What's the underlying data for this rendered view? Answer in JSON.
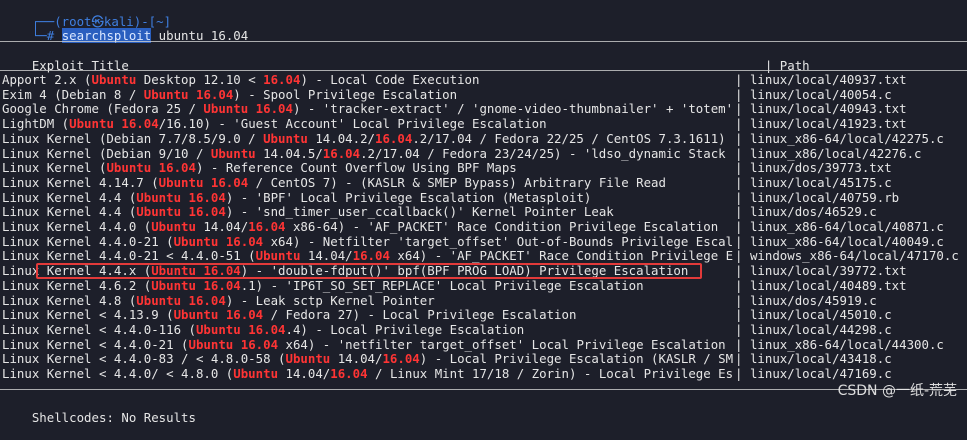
{
  "prompt": {
    "top_line": "┌──(root㉿kali)-[~]",
    "cmd_prefix": "└─# ",
    "command": "searchsploit",
    "args": " ubuntu 16.04"
  },
  "table": {
    "header_title": "Exploit Title",
    "header_pipe": "|",
    "header_path": "Path",
    "rows": [
      {
        "segments": [
          {
            "t": "Apport 2.x (",
            "c": "white"
          },
          {
            "t": "Ubuntu",
            "c": "red"
          },
          {
            "t": " Desktop 12.10 < ",
            "c": "white"
          },
          {
            "t": "16.04",
            "c": "red"
          },
          {
            "t": ") - Local Code Execution",
            "c": "white"
          }
        ],
        "path": "linux/local/40937.txt"
      },
      {
        "segments": [
          {
            "t": "Exim 4 (Debian 8 / ",
            "c": "white"
          },
          {
            "t": "Ubuntu",
            "c": "red"
          },
          {
            "t": " ",
            "c": "white"
          },
          {
            "t": "16.04",
            "c": "red"
          },
          {
            "t": ") - Spool Privilege Escalation",
            "c": "white"
          }
        ],
        "path": "linux/local/40054.c"
      },
      {
        "segments": [
          {
            "t": "Google Chrome (Fedora 25 / ",
            "c": "white"
          },
          {
            "t": "Ubuntu",
            "c": "red"
          },
          {
            "t": " ",
            "c": "white"
          },
          {
            "t": "16.04",
            "c": "red"
          },
          {
            "t": ") - 'tracker-extract' / 'gnome-video-thumbnailer' + 'totem'",
            "c": "white"
          }
        ],
        "path": "linux/local/40943.txt"
      },
      {
        "segments": [
          {
            "t": "LightDM (",
            "c": "white"
          },
          {
            "t": "Ubuntu",
            "c": "red"
          },
          {
            "t": " ",
            "c": "white"
          },
          {
            "t": "16.04",
            "c": "red"
          },
          {
            "t": "/16.10) - 'Guest Account' Local Privilege Escalation",
            "c": "white"
          }
        ],
        "path": "linux/local/41923.txt"
      },
      {
        "segments": [
          {
            "t": "Linux Kernel (Debian 7.7/8.5/9.0 / ",
            "c": "white"
          },
          {
            "t": "Ubuntu",
            "c": "red"
          },
          {
            "t": " 14.04.2/",
            "c": "white"
          },
          {
            "t": "16.04",
            "c": "red"
          },
          {
            "t": ".2/17.04 / Fedora 22/25 / CentOS 7.3.1611)",
            "c": "white"
          }
        ],
        "path": "linux_x86-64/local/42275.c"
      },
      {
        "segments": [
          {
            "t": "Linux Kernel (Debian 9/10 / ",
            "c": "white"
          },
          {
            "t": "Ubuntu",
            "c": "red"
          },
          {
            "t": " 14.04.5/",
            "c": "white"
          },
          {
            "t": "16.04",
            "c": "red"
          },
          {
            "t": ".2/17.04 / Fedora 23/24/25) - 'ldso_dynamic Stack",
            "c": "white"
          }
        ],
        "path": "linux_x86/local/42276.c"
      },
      {
        "segments": [
          {
            "t": "Linux Kernel (",
            "c": "white"
          },
          {
            "t": "Ubuntu",
            "c": "red"
          },
          {
            "t": " ",
            "c": "white"
          },
          {
            "t": "16.04",
            "c": "red"
          },
          {
            "t": ") - Reference Count Overflow Using BPF Maps",
            "c": "white"
          }
        ],
        "path": "linux/dos/39773.txt"
      },
      {
        "segments": [
          {
            "t": "Linux Kernel 4.14.7 (",
            "c": "white"
          },
          {
            "t": "Ubuntu",
            "c": "red"
          },
          {
            "t": " ",
            "c": "white"
          },
          {
            "t": "16.04",
            "c": "red"
          },
          {
            "t": " / CentOS 7) - (KASLR & SMEP Bypass) Arbitrary File Read",
            "c": "white"
          }
        ],
        "path": "linux/local/45175.c"
      },
      {
        "segments": [
          {
            "t": "Linux Kernel 4.4 (",
            "c": "white"
          },
          {
            "t": "Ubuntu",
            "c": "red"
          },
          {
            "t": " ",
            "c": "white"
          },
          {
            "t": "16.04",
            "c": "red"
          },
          {
            "t": ") - 'BPF' Local Privilege Escalation (Metasploit)",
            "c": "white"
          }
        ],
        "path": "linux/local/40759.rb"
      },
      {
        "segments": [
          {
            "t": "Linux Kernel 4.4 (",
            "c": "white"
          },
          {
            "t": "Ubuntu",
            "c": "red"
          },
          {
            "t": " ",
            "c": "white"
          },
          {
            "t": "16.04",
            "c": "red"
          },
          {
            "t": ") - 'snd_timer_user_ccallback()' Kernel Pointer Leak",
            "c": "white"
          }
        ],
        "path": "linux/dos/46529.c"
      },
      {
        "segments": [
          {
            "t": "Linux Kernel 4.4.0 (",
            "c": "white"
          },
          {
            "t": "Ubuntu",
            "c": "red"
          },
          {
            "t": " 14.04/",
            "c": "white"
          },
          {
            "t": "16.04",
            "c": "red"
          },
          {
            "t": " x86-64) - 'AF_PACKET' Race Condition Privilege Escalation",
            "c": "white"
          }
        ],
        "path": "linux_x86-64/local/40871.c"
      },
      {
        "segments": [
          {
            "t": "Linux Kernel 4.4.0-21 (",
            "c": "white"
          },
          {
            "t": "Ubuntu",
            "c": "red"
          },
          {
            "t": " ",
            "c": "white"
          },
          {
            "t": "16.04",
            "c": "red"
          },
          {
            "t": " x64) - Netfilter 'target_offset' Out-of-Bounds Privilege Escal",
            "c": "white"
          }
        ],
        "path": "linux_x86-64/local/40049.c"
      },
      {
        "segments": [
          {
            "t": "Linux Kernel 4.4.0-21 < 4.4.0-51 (",
            "c": "white"
          },
          {
            "t": "Ubuntu",
            "c": "red"
          },
          {
            "t": " 14.04/",
            "c": "white"
          },
          {
            "t": "16.04",
            "c": "red"
          },
          {
            "t": " x64) - 'AF_PACKET' Race Condition Privilege E",
            "c": "white"
          }
        ],
        "path": "windows_x86-64/local/47170.c"
      },
      {
        "segments": [
          {
            "t": "Linux Kernel 4.4.x (",
            "c": "white"
          },
          {
            "t": "Ubuntu",
            "c": "red"
          },
          {
            "t": " ",
            "c": "white"
          },
          {
            "t": "16.04",
            "c": "red"
          },
          {
            "t": ") - 'double-fdput()' bpf(BPF_PROG_LOAD) Privilege Escalation",
            "c": "white"
          }
        ],
        "path": "linux/local/39772.txt"
      },
      {
        "segments": [
          {
            "t": "Linux Kernel 4.6.2 (",
            "c": "white"
          },
          {
            "t": "Ubuntu",
            "c": "red"
          },
          {
            "t": " ",
            "c": "white"
          },
          {
            "t": "16.04",
            "c": "red"
          },
          {
            "t": ".1) - 'IP6T_SO_SET_REPLACE' Local Privilege Escalation",
            "c": "white"
          }
        ],
        "path": "linux/local/40489.txt"
      },
      {
        "segments": [
          {
            "t": "Linux Kernel 4.8 (",
            "c": "white"
          },
          {
            "t": "Ubuntu",
            "c": "red"
          },
          {
            "t": " ",
            "c": "white"
          },
          {
            "t": "16.04",
            "c": "red"
          },
          {
            "t": ") - Leak sctp Kernel Pointer",
            "c": "white"
          }
        ],
        "path": "linux/dos/45919.c"
      },
      {
        "segments": [
          {
            "t": "Linux Kernel < 4.13.9 (",
            "c": "white"
          },
          {
            "t": "Ubuntu",
            "c": "red"
          },
          {
            "t": " ",
            "c": "white"
          },
          {
            "t": "16.04",
            "c": "red"
          },
          {
            "t": " / Fedora 27) - Local Privilege Escalation",
            "c": "white"
          }
        ],
        "path": "linux/local/45010.c"
      },
      {
        "segments": [
          {
            "t": "Linux Kernel < 4.4.0-116 (",
            "c": "white"
          },
          {
            "t": "Ubuntu",
            "c": "red"
          },
          {
            "t": " ",
            "c": "white"
          },
          {
            "t": "16.04",
            "c": "red"
          },
          {
            "t": ".4) - Local Privilege Escalation",
            "c": "white"
          }
        ],
        "path": "linux/local/44298.c"
      },
      {
        "segments": [
          {
            "t": "Linux Kernel < 4.4.0-21 (",
            "c": "white"
          },
          {
            "t": "Ubuntu",
            "c": "red"
          },
          {
            "t": " ",
            "c": "white"
          },
          {
            "t": "16.04",
            "c": "red"
          },
          {
            "t": " x64) - 'netfilter target_offset' Local Privilege Escalation",
            "c": "white"
          }
        ],
        "path": "linux_x86-64/local/44300.c"
      },
      {
        "segments": [
          {
            "t": "Linux Kernel < 4.4.0-83 / < 4.8.0-58 (",
            "c": "white"
          },
          {
            "t": "Ubuntu",
            "c": "red"
          },
          {
            "t": " 14.04/",
            "c": "white"
          },
          {
            "t": "16.04",
            "c": "red"
          },
          {
            "t": ") - Local Privilege Escalation (KASLR / SM",
            "c": "white"
          }
        ],
        "path": "linux/local/43418.c"
      },
      {
        "segments": [
          {
            "t": "Linux Kernel < 4.4.0/ < 4.8.0 (",
            "c": "white"
          },
          {
            "t": "Ubuntu",
            "c": "red"
          },
          {
            "t": " 14.04/",
            "c": "white"
          },
          {
            "t": "16.04",
            "c": "red"
          },
          {
            "t": " / Linux Mint 17/18 / Zorin) - Local Privilege Es",
            "c": "white"
          }
        ],
        "path": "linux/local/47169.c"
      }
    ],
    "row_pipe": "|",
    "footer": "Shellcodes: No Results"
  },
  "watermark": "CSDN @一纸-荒芜",
  "colors": {
    "background": "#1d1f2a",
    "accent_red": "#ff3434",
    "prompt_blue": "#3f7fe0",
    "highlight_box": "#e23a3a"
  }
}
